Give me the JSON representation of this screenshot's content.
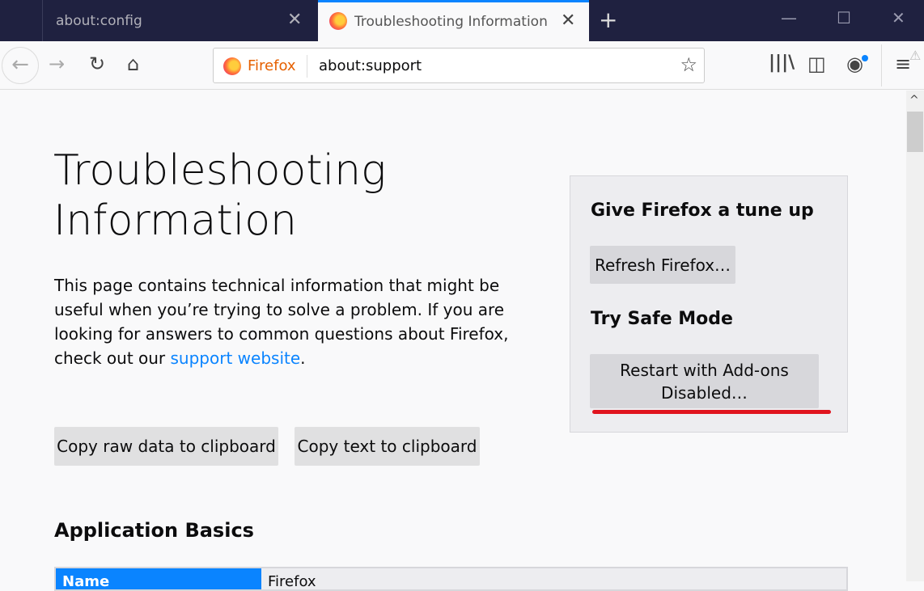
{
  "tabs": [
    {
      "label": "about:config",
      "active": false
    },
    {
      "label": "Troubleshooting Information",
      "active": true
    }
  ],
  "toolbar": {
    "identity": "Firefox",
    "url": "about:support"
  },
  "page": {
    "title": "Troubleshooting Information",
    "intro": "This page contains technical information that might be useful when you’re trying to solve a problem. If you are looking for answers to common questions about Firefox, check out our ",
    "intro_link": "support website",
    "intro_end": ".",
    "copy_raw": "Copy raw data to clipboard",
    "copy_text": "Copy text to clipboard",
    "tuneup_title": "Give Firefox a tune up",
    "refresh": "Refresh Firefox…",
    "safe_title": "Try Safe Mode",
    "restart": "Restart with Add-ons Disabled…",
    "section": "Application Basics",
    "table": [
      {
        "key": "Name",
        "value": "Firefox"
      }
    ]
  },
  "colors": {
    "accent": "#0a84ff",
    "frame": "#1f2140",
    "annotation": "#e0141e"
  }
}
